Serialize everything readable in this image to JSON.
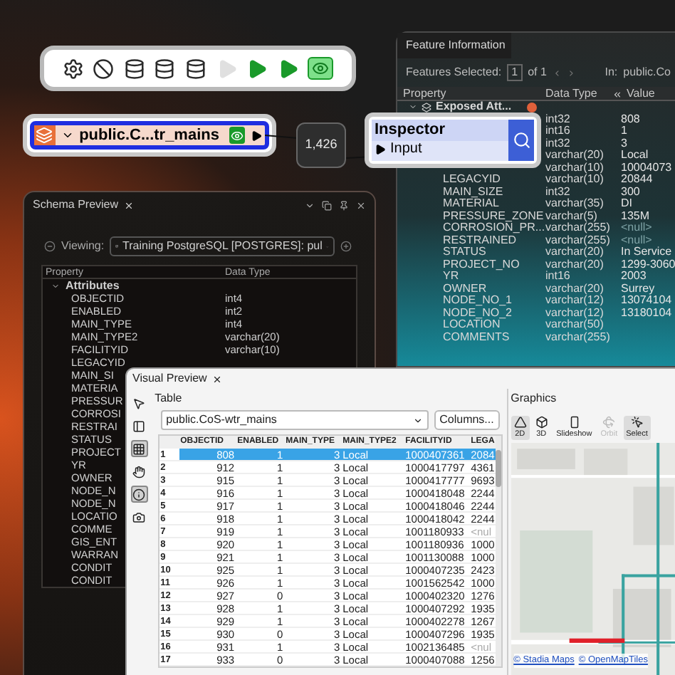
{
  "toolbar": {
    "buttons": [
      {
        "kind": "gear",
        "disabled": false
      },
      {
        "kind": "ban",
        "disabled": false
      },
      {
        "kind": "database",
        "disabled": false
      },
      {
        "kind": "database",
        "disabled": false
      },
      {
        "kind": "database",
        "disabled": false
      },
      {
        "kind": "run",
        "disabled": true
      },
      {
        "kind": "run",
        "disabled": false
      },
      {
        "kind": "run",
        "disabled": false
      },
      {
        "kind": "eye",
        "disabled": false,
        "on": true
      }
    ]
  },
  "source_node": {
    "title": "public.C...tr_mains",
    "preview_on": true
  },
  "connector": {
    "count": "1,426"
  },
  "inspector": {
    "title": "Inspector",
    "port": "Input"
  },
  "feature_info": {
    "title": "Feature Information",
    "selected_label": "Features Selected:",
    "index": "1",
    "of": "of 1",
    "in_label": "In:",
    "in_value": "public.Co",
    "columns": [
      "Property",
      "Data Type",
      "Value"
    ],
    "group": {
      "name": "Exposed Att...",
      "expanded": true
    },
    "rows": [
      {
        "data_type": "int32",
        "value": "808",
        "is_null": false
      },
      {
        "data_type": "int16",
        "value": "1",
        "is_null": false
      },
      {
        "data_type": "int32",
        "value": "3",
        "is_null": false
      },
      {
        "data_type": "varchar(20)",
        "value": "Local",
        "is_null": false
      },
      {
        "data_type": "varchar(10)",
        "value": "10004073",
        "is_null": false
      },
      {
        "property": "LEGACYID",
        "data_type": "varchar(10)",
        "value": "20844",
        "is_null": false
      },
      {
        "property": "MAIN_SIZE",
        "data_type": "int32",
        "value": "300",
        "is_null": false
      },
      {
        "property": "MATERIAL",
        "data_type": "varchar(35)",
        "value": "DI",
        "is_null": false
      },
      {
        "property": "PRESSURE_ZONE",
        "data_type": "varchar(5)",
        "value": "135M",
        "is_null": false
      },
      {
        "property": "CORROSION_PR...",
        "data_type": "varchar(255)",
        "value": "<null>",
        "is_null": true
      },
      {
        "property": "RESTRAINED",
        "data_type": "varchar(255)",
        "value": "<null>",
        "is_null": true
      },
      {
        "property": "STATUS",
        "data_type": "varchar(20)",
        "value": "In Service",
        "is_null": false
      },
      {
        "property": "PROJECT_NO",
        "data_type": "varchar(20)",
        "value": "1299-3060",
        "is_null": false
      },
      {
        "property": "YR",
        "data_type": "int16",
        "value": "2003",
        "is_null": false
      },
      {
        "property": "OWNER",
        "data_type": "varchar(20)",
        "value": "Surrey",
        "is_null": false
      },
      {
        "property": "NODE_NO_1",
        "data_type": "varchar(12)",
        "value": "13074104",
        "is_null": false
      },
      {
        "property": "NODE_NO_2",
        "data_type": "varchar(12)",
        "value": "13180104",
        "is_null": false
      },
      {
        "property": "LOCATION",
        "data_type": "varchar(50)"
      },
      {
        "property": "COMMENTS",
        "data_type": "varchar(255)"
      }
    ]
  },
  "schema_preview": {
    "title": "Schema Preview",
    "viewing_label": "Viewing:",
    "source": "Training PostgreSQL [POSTGRES]: pul",
    "columns": [
      "Property",
      "Data Type"
    ],
    "group": {
      "name": "Attributes",
      "expanded": true
    },
    "rows": [
      {
        "property": "OBJECTID",
        "data_type": "int4"
      },
      {
        "property": "ENABLED",
        "data_type": "int2"
      },
      {
        "property": "MAIN_TYPE",
        "data_type": "int4"
      },
      {
        "property": "MAIN_TYPE2",
        "data_type": "varchar(20)"
      },
      {
        "property": "FACILITYID",
        "data_type": "varchar(10)"
      },
      {
        "property": "LEGACYID"
      },
      {
        "property": "MAIN_SI"
      },
      {
        "property": "MATERIA"
      },
      {
        "property": "PRESSUR"
      },
      {
        "property": "CORROSI"
      },
      {
        "property": "RESTRAI"
      },
      {
        "property": "STATUS"
      },
      {
        "property": "PROJECT"
      },
      {
        "property": "YR"
      },
      {
        "property": "OWNER"
      },
      {
        "property": "NODE_N"
      },
      {
        "property": "NODE_N"
      },
      {
        "property": "LOCATIO"
      },
      {
        "property": "COMME"
      },
      {
        "property": "GIS_ENT"
      },
      {
        "property": "WARRAN"
      },
      {
        "property": "CONDIT"
      },
      {
        "property": "CONDIT"
      }
    ]
  },
  "visual_preview": {
    "title": "Visual Preview",
    "tools": [
      {
        "kind": "pointer",
        "selected": false
      },
      {
        "kind": "panel",
        "selected": false
      },
      {
        "kind": "grid",
        "selected": true
      },
      {
        "kind": "hand",
        "selected": false
      },
      {
        "kind": "info",
        "selected": true
      },
      {
        "kind": "camera",
        "selected": false
      }
    ],
    "table": {
      "label": "Table",
      "source": "public.CoS-wtr_mains",
      "columns_button": "Columns...",
      "columns": [
        "OBJECTID",
        "ENABLED",
        "MAIN_TYPE",
        "MAIN_TYPE2",
        "FACILITYID",
        "LEGA"
      ],
      "rows": [
        {
          "n": "1",
          "cells": [
            "808",
            "1",
            "3",
            "Local",
            "1000407361"
          ],
          "last": "2084",
          "last_null": false,
          "selected": true
        },
        {
          "n": "2",
          "cells": [
            "912",
            "1",
            "3",
            "Local",
            "1000417797"
          ],
          "last": "4361",
          "last_null": false,
          "selected": false
        },
        {
          "n": "3",
          "cells": [
            "915",
            "1",
            "3",
            "Local",
            "1000417777"
          ],
          "last": "9693",
          "last_null": false,
          "selected": false
        },
        {
          "n": "4",
          "cells": [
            "916",
            "1",
            "3",
            "Local",
            "1000418048"
          ],
          "last": "2244",
          "last_null": false,
          "selected": false
        },
        {
          "n": "5",
          "cells": [
            "917",
            "1",
            "3",
            "Local",
            "1000418046"
          ],
          "last": "2244",
          "last_null": false,
          "selected": false
        },
        {
          "n": "6",
          "cells": [
            "918",
            "1",
            "3",
            "Local",
            "1000418042"
          ],
          "last": "2244",
          "last_null": false,
          "selected": false
        },
        {
          "n": "7",
          "cells": [
            "919",
            "1",
            "3",
            "Local",
            "1001180933"
          ],
          "last": "<nul",
          "last_null": true,
          "selected": false
        },
        {
          "n": "8",
          "cells": [
            "920",
            "1",
            "3",
            "Local",
            "1001180936"
          ],
          "last": "1000",
          "last_null": false,
          "selected": false
        },
        {
          "n": "9",
          "cells": [
            "921",
            "1",
            "3",
            "Local",
            "1001130088"
          ],
          "last": "1000",
          "last_null": false,
          "selected": false
        },
        {
          "n": "10",
          "cells": [
            "925",
            "1",
            "3",
            "Local",
            "1000407235"
          ],
          "last": "2423",
          "last_null": false,
          "selected": false
        },
        {
          "n": "11",
          "cells": [
            "926",
            "1",
            "3",
            "Local",
            "1001562542"
          ],
          "last": "1000",
          "last_null": false,
          "selected": false
        },
        {
          "n": "12",
          "cells": [
            "927",
            "0",
            "3",
            "Local",
            "1000402320"
          ],
          "last": "1276",
          "last_null": false,
          "selected": false
        },
        {
          "n": "13",
          "cells": [
            "928",
            "1",
            "3",
            "Local",
            "1000407292"
          ],
          "last": "1935",
          "last_null": false,
          "selected": false
        },
        {
          "n": "14",
          "cells": [
            "929",
            "1",
            "3",
            "Local",
            "1000402278"
          ],
          "last": "1267",
          "last_null": false,
          "selected": false
        },
        {
          "n": "15",
          "cells": [
            "930",
            "0",
            "3",
            "Local",
            "1000407296"
          ],
          "last": "1935",
          "last_null": false,
          "selected": false
        },
        {
          "n": "16",
          "cells": [
            "931",
            "1",
            "3",
            "Local",
            "1002136485"
          ],
          "last": "<nul",
          "last_null": true,
          "selected": false
        },
        {
          "n": "17",
          "cells": [
            "933",
            "0",
            "3",
            "Local",
            "1000407088"
          ],
          "last": "1256",
          "last_null": false,
          "selected": false
        }
      ]
    },
    "graphics": {
      "label": "Graphics",
      "tools": [
        {
          "kind": "flat",
          "label": "2D",
          "selected": true,
          "disabled": false
        },
        {
          "kind": "cube",
          "label": "3D",
          "selected": false,
          "disabled": false
        },
        {
          "kind": "slideshow",
          "label": "Slideshow",
          "selected": false,
          "disabled": false
        },
        {
          "kind": "orbit",
          "label": "Orbit",
          "selected": false,
          "disabled": true
        },
        {
          "kind": "select",
          "label": "Select",
          "selected": true,
          "disabled": false
        }
      ],
      "attribution": [
        "© Stadia Maps",
        "© OpenMapTiles"
      ]
    }
  }
}
